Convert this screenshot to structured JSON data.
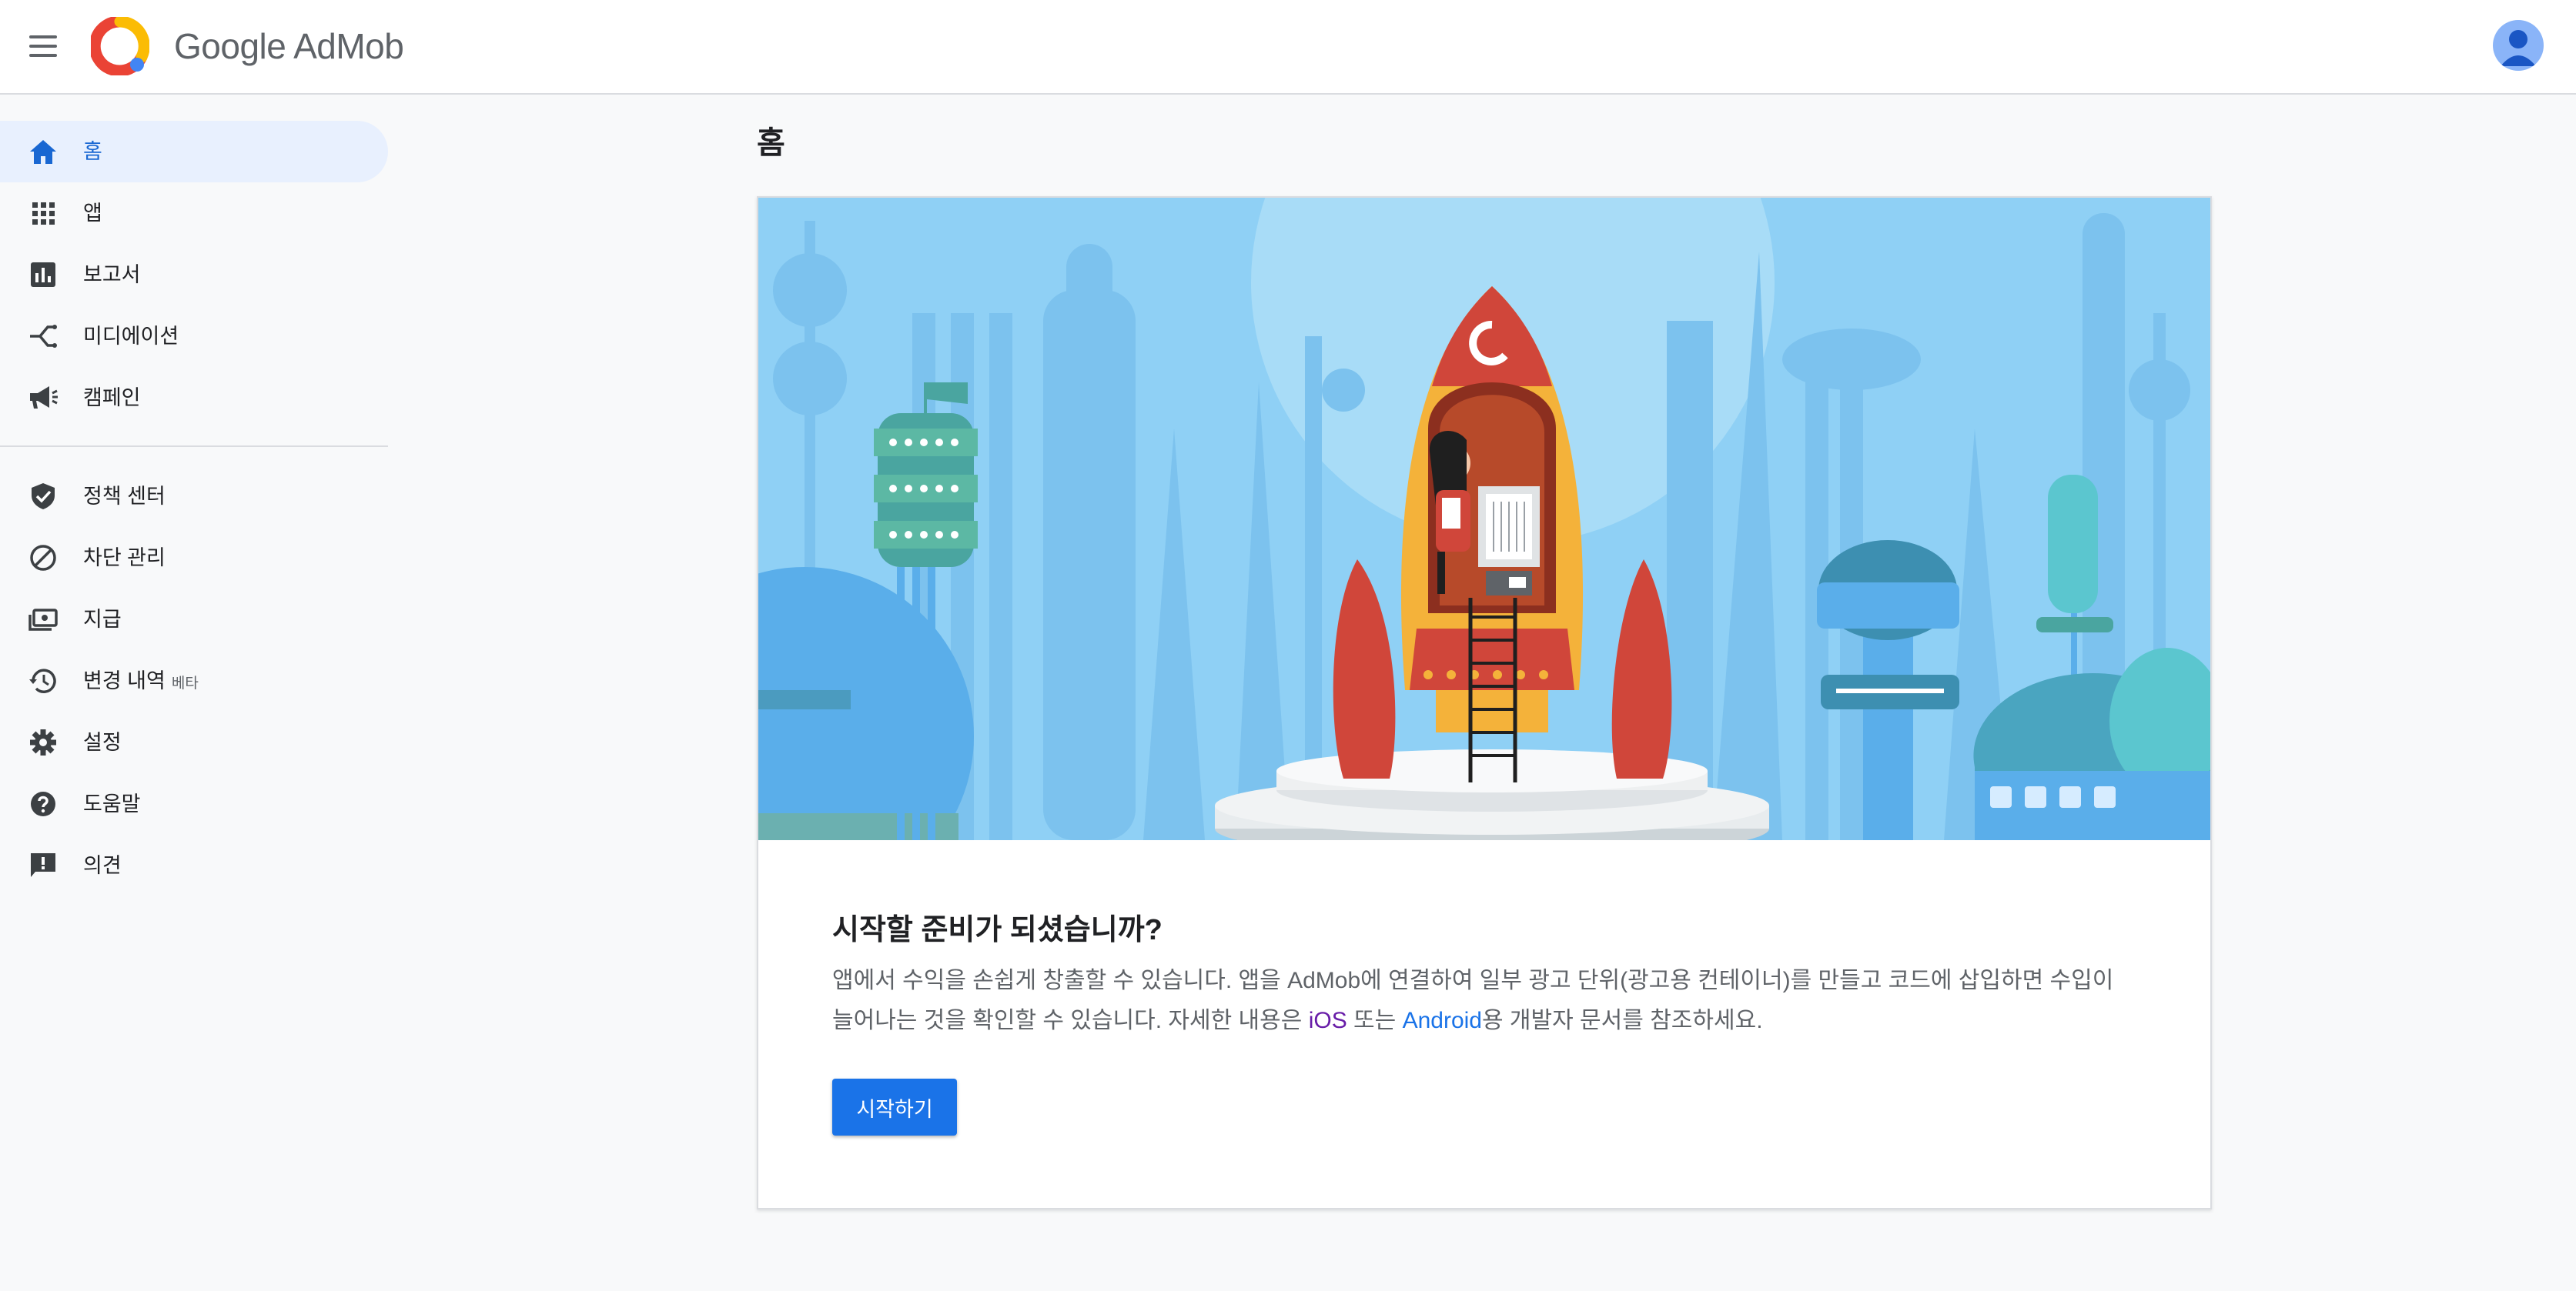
{
  "header": {
    "brand_google": "Google",
    "brand_product": "AdMob"
  },
  "sidebar": {
    "items": [
      {
        "label": "홈",
        "icon": "home-icon",
        "active": true
      },
      {
        "label": "앱",
        "icon": "apps-grid-icon"
      },
      {
        "label": "보고서",
        "icon": "bar-chart-icon"
      },
      {
        "label": "미디에이션",
        "icon": "mediation-icon"
      },
      {
        "label": "캠페인",
        "icon": "megaphone-icon"
      }
    ],
    "items_secondary": [
      {
        "label": "정책 센터",
        "icon": "shield-check-icon"
      },
      {
        "label": "차단 관리",
        "icon": "block-icon"
      },
      {
        "label": "지급",
        "icon": "payments-icon"
      },
      {
        "label": "변경 내역",
        "badge": "베타",
        "icon": "history-icon"
      },
      {
        "label": "설정",
        "icon": "gear-icon"
      },
      {
        "label": "도움말",
        "icon": "help-icon"
      },
      {
        "label": "의견",
        "icon": "feedback-icon"
      }
    ]
  },
  "main": {
    "page_title": "홈",
    "card": {
      "title": "시작할 준비가 되셨습니까?",
      "body_before": "앱에서 수익을 손쉽게 창출할 수 있습니다. 앱을 AdMob에 연결하여 일부 광고 단위(광고용 컨테이너)를 만들고 코드에 삽입하면 수입이 늘어나는 것을 확인할 수 있습니다. 자세한 내용은 ",
      "link_ios": "iOS",
      "body_middle": " 또는 ",
      "link_android": "Android",
      "body_after": "용 개발자 문서를 참조하세요.",
      "start_button": "시작하기"
    }
  },
  "colors": {
    "accent": "#1a73e8",
    "nav_active_bg": "#e8f0fe",
    "hero_sky": "#8fd0f5"
  }
}
